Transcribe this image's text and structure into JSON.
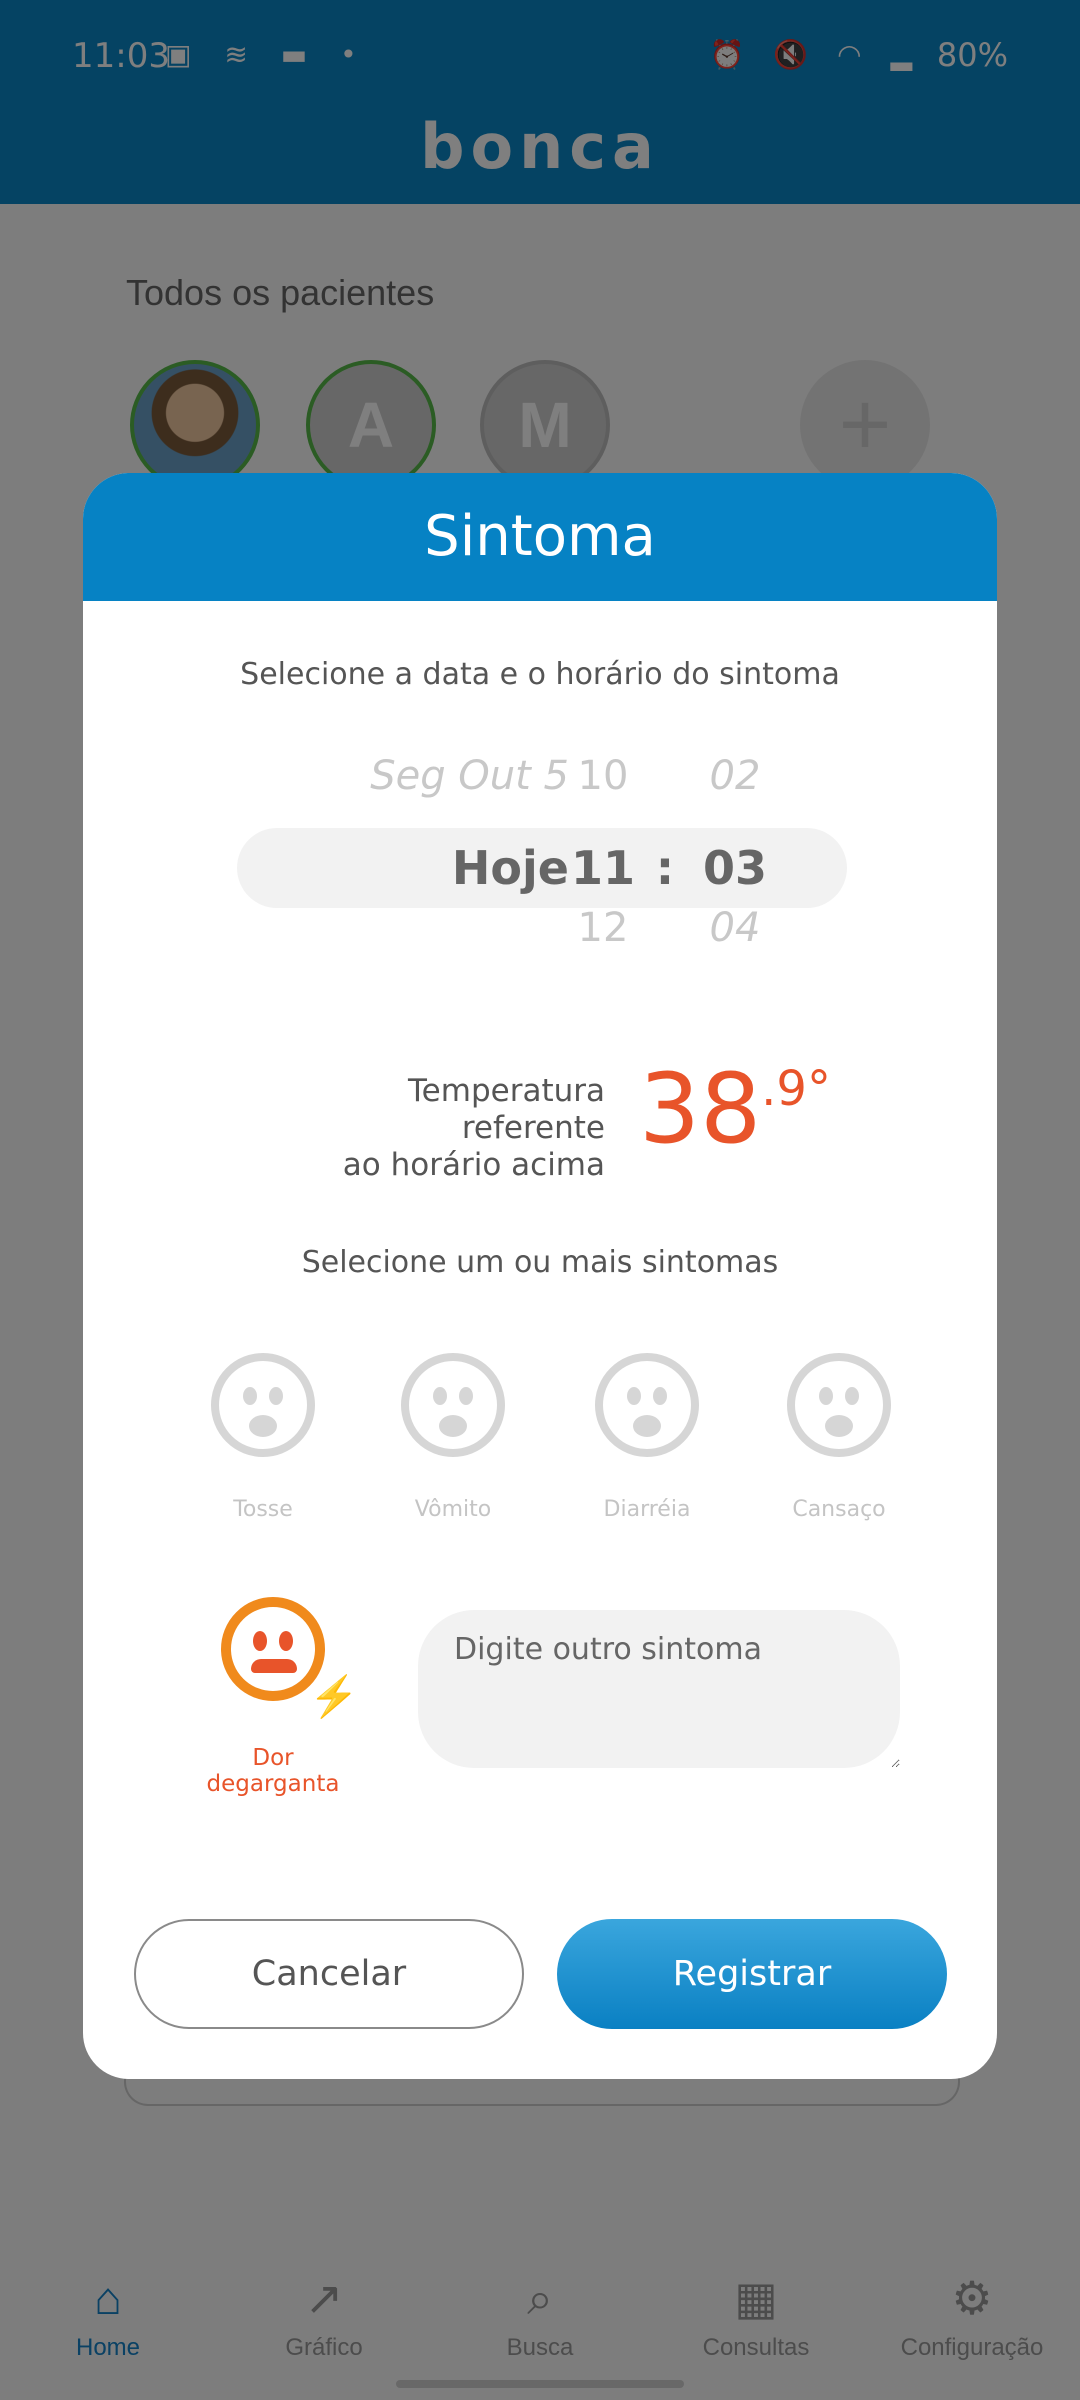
{
  "status_bar": {
    "time": "11:03",
    "left_icons": "▣ ≋ ▬ •",
    "right_icons": "⏰ 🔇 ◠ ▂",
    "battery": "80%"
  },
  "app": {
    "logo": "bonca"
  },
  "background": {
    "section_title": "Todos os pacientes",
    "patients": [
      {
        "initial": ""
      },
      {
        "initial": "A"
      },
      {
        "initial": "M"
      }
    ],
    "add_symbol": "+",
    "nav": [
      {
        "label": "Home",
        "icon": "⌂"
      },
      {
        "label": "Gráfico",
        "icon": "↗"
      },
      {
        "label": "Busca",
        "icon": "⌕"
      },
      {
        "label": "Consultas",
        "icon": "▦"
      },
      {
        "label": "Configuração",
        "icon": "⚙"
      }
    ]
  },
  "modal": {
    "title": "Sintoma",
    "date_instruction": "Selecione a data e o horário do sintoma",
    "picker": {
      "date_prev": "Seg Out 5",
      "date_selected": "Hoje",
      "hour_prev": "10",
      "hour_selected": "11",
      "hour_next": "12",
      "separator": ":",
      "minute_prev": "02",
      "minute_selected": "03",
      "minute_next": "04"
    },
    "temperature_label_line1": "Temperatura referente",
    "temperature_label_line2": "ao horário acima",
    "temperature_int": "38",
    "temperature_dec": ".9°",
    "symptoms_instruction": "Selecione um ou mais sintomas",
    "symptoms": [
      {
        "label": "Tosse"
      },
      {
        "label": "Vômito"
      },
      {
        "label": "Diarréia"
      },
      {
        "label": "Cansaço"
      }
    ],
    "selected_symptom": {
      "label": "Dor degarganta",
      "icon_symbol": "⚡"
    },
    "other_placeholder": "Digite outro sintoma",
    "cancel_label": "Cancelar",
    "register_label": "Registrar"
  },
  "colors": {
    "primary": "#0682c4",
    "accent": "#e8542a",
    "selected_icon": "#f08a1c"
  }
}
